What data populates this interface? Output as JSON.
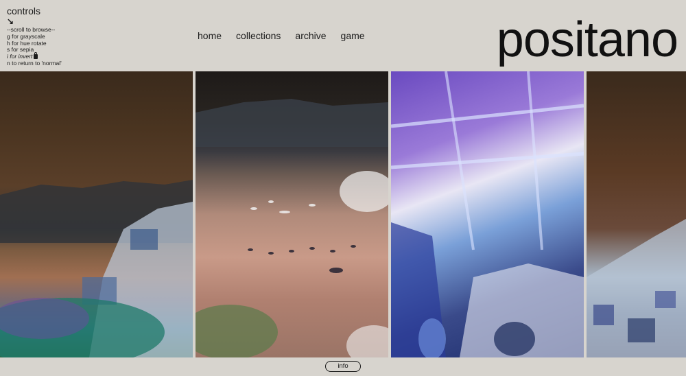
{
  "controls": {
    "title": "controls",
    "arrow": "↘",
    "lines": [
      "--scroll to browse--",
      "g for grayscale",
      "h for hue rotate",
      "s for sepia",
      "i for invert",
      "n to return to 'normal'"
    ]
  },
  "nav": {
    "items": [
      "home",
      "collections",
      "archive",
      "game"
    ]
  },
  "brand": {
    "title": "positano"
  },
  "info_button": {
    "label": "info"
  },
  "colors": {
    "background": "#d7d4ce",
    "text": "#1b1b1b"
  }
}
